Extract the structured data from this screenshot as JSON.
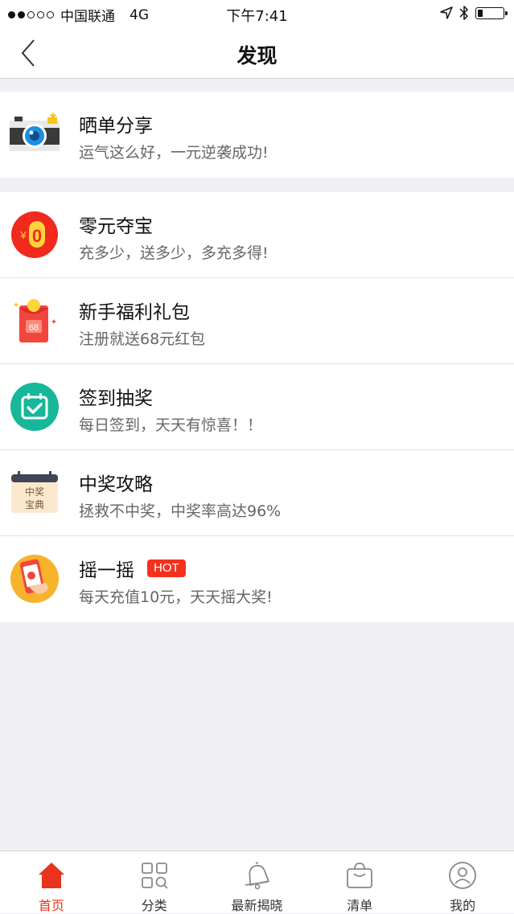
{
  "status_bar": {
    "carrier": "中国联通",
    "network": "4G",
    "time": "下午7:41",
    "battery_level": 0.2
  },
  "nav": {
    "title": "发现",
    "back_icon": "chevron-left-icon"
  },
  "groups": [
    {
      "items": [
        {
          "title": "晒单分享",
          "subtitle": "运气这么好，一元逆袭成功!",
          "icon": "camera-icon"
        }
      ]
    },
    {
      "items": [
        {
          "title": "零元夺宝",
          "subtitle": "充多少，送多少，多充多得!",
          "icon": "zero-coin-icon",
          "icon_text": "¥0"
        },
        {
          "title": "新手福利礼包",
          "subtitle": "注册就送68元红包",
          "icon": "red-envelope-icon",
          "icon_text": "68"
        },
        {
          "title": "签到抽奖",
          "subtitle": "每日签到，天天有惊喜！！",
          "icon": "calendar-check-icon"
        },
        {
          "title": "中奖攻略",
          "subtitle": "拯救不中奖，中奖率高达96%",
          "icon": "guide-book-icon",
          "icon_text_1": "中奖",
          "icon_text_2": "宝典"
        },
        {
          "title": "摇一摇",
          "badge": "HOT",
          "subtitle": "每天充值10元，天天摇大奖!",
          "icon": "shake-phone-icon"
        }
      ]
    }
  ],
  "tabbar": {
    "items": [
      {
        "label": "首页",
        "icon": "home-icon",
        "active": true
      },
      {
        "label": "分类",
        "icon": "category-grid-icon",
        "active": false
      },
      {
        "label": "最新揭晓",
        "icon": "bell-icon",
        "active": false
      },
      {
        "label": "清单",
        "icon": "shopping-bag-icon",
        "active": false
      },
      {
        "label": "我的",
        "icon": "user-icon",
        "active": false
      }
    ]
  },
  "colors": {
    "accent": "#e8341c",
    "hot_badge": "#f5311e",
    "background": "#efeff4"
  }
}
